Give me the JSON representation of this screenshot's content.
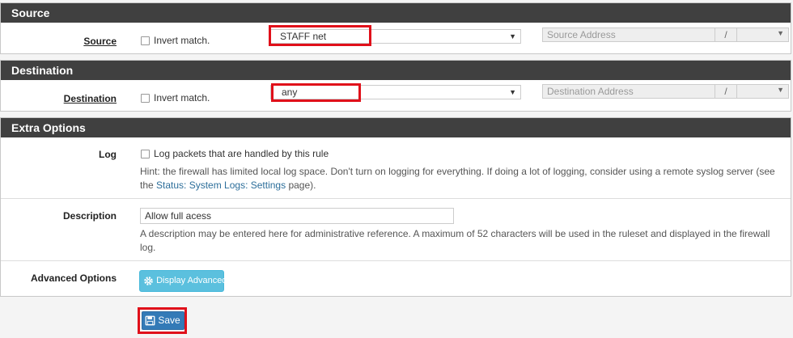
{
  "source": {
    "section_title": "Source",
    "label": "Source",
    "invert_label": "Invert match.",
    "selected": "STAFF net",
    "address_placeholder": "Source Address",
    "slash": "/"
  },
  "destination": {
    "section_title": "Destination",
    "label": "Destination",
    "invert_label": "Invert match.",
    "selected": "any",
    "address_placeholder": "Destination Address",
    "slash": "/"
  },
  "extra": {
    "section_title": "Extra Options",
    "log_label": "Log",
    "log_checkbox_label": "Log packets that are handled by this rule",
    "log_hint_prefix": "Hint: the firewall has limited local log space. Don't turn on logging for everything. If doing a lot of logging, consider using a remote syslog server (see the",
    "log_hint_link": "Status: System Logs: Settings",
    "log_hint_suffix": "page).",
    "description_label": "Description",
    "description_value": "Allow full acess",
    "description_hint": "A description may be entered here for administrative reference. A maximum of 52 characters will be used in the ruleset and displayed in the firewall log.",
    "advanced_label": "Advanced Options",
    "advanced_button": "Display Advanced"
  },
  "save_button": "Save",
  "colors": {
    "header": "#404040",
    "highlight": "#e0101a",
    "info_button": "#5bc0de",
    "primary_button": "#337ab7",
    "link": "#2c6e9a"
  }
}
